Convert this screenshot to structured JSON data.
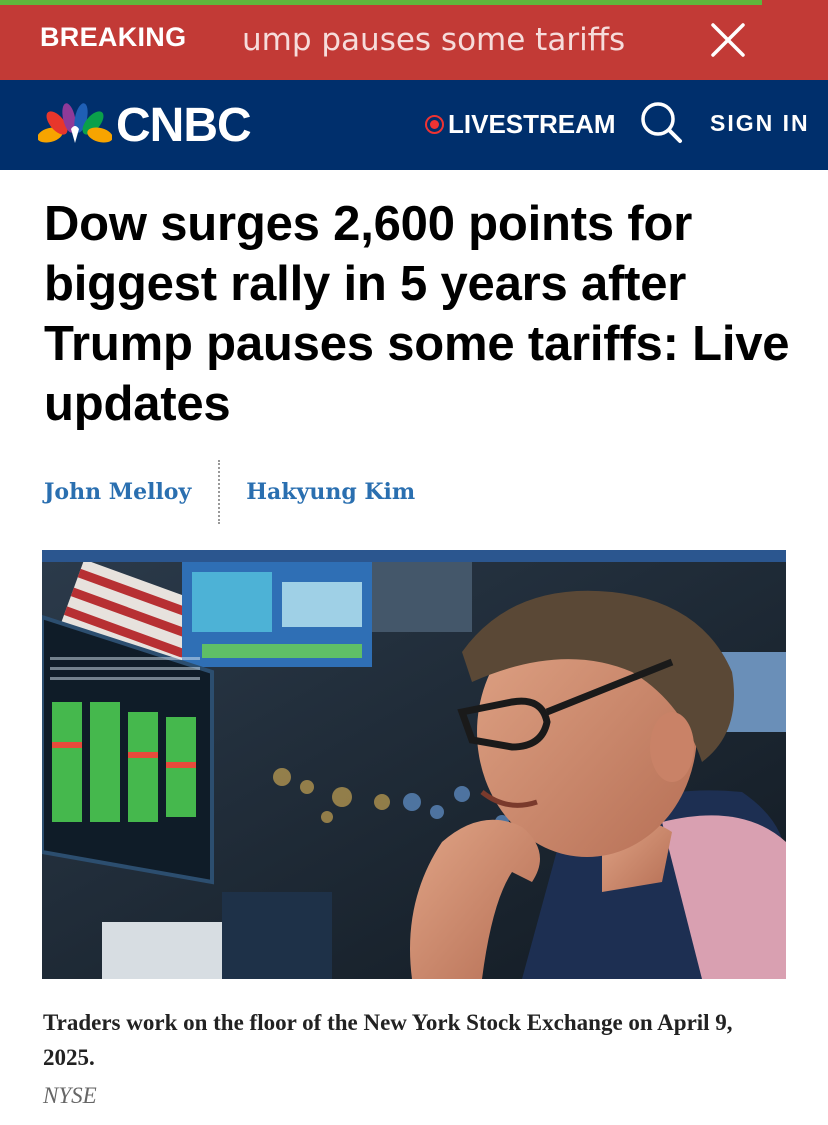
{
  "breaking": {
    "tag": "BREAKING",
    "ticker": "ump pauses some tariffs",
    "close_icon": "close-icon",
    "progress": 0.92,
    "colors": {
      "background": "#c23a36",
      "progress": "#5fb53c"
    }
  },
  "header": {
    "logo": "CNBC",
    "logo_icon": "peacock-icon",
    "livestream": "LIVESTREAM",
    "search_icon": "search-icon",
    "sign_in": "SIGN IN",
    "background": "#002f6c"
  },
  "article": {
    "headline": "Dow surges 2,600 points for biggest rally in 5 years after Trump pauses some tariffs: Live updates",
    "authors": [
      "John Melloy",
      "Hakyung Kim"
    ],
    "caption": "Traders work on the floor of the New York Stock Exchange on April 9, 2025.",
    "credit": "NYSE",
    "accent": "#2b568f"
  }
}
